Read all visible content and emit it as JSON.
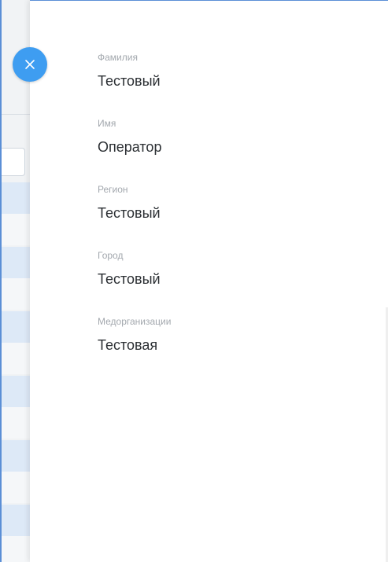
{
  "drawer": {
    "close_icon": "close-icon",
    "accent_color": "#3e9df1",
    "fields": [
      {
        "label": "Фамилия",
        "value": "Тестовый"
      },
      {
        "label": "Имя",
        "value": "Оператор"
      },
      {
        "label": "Регион",
        "value": "Тестовый"
      },
      {
        "label": "Город",
        "value": "Тестовый"
      },
      {
        "label": "Медорганизации",
        "value": "Тестовая"
      }
    ]
  }
}
